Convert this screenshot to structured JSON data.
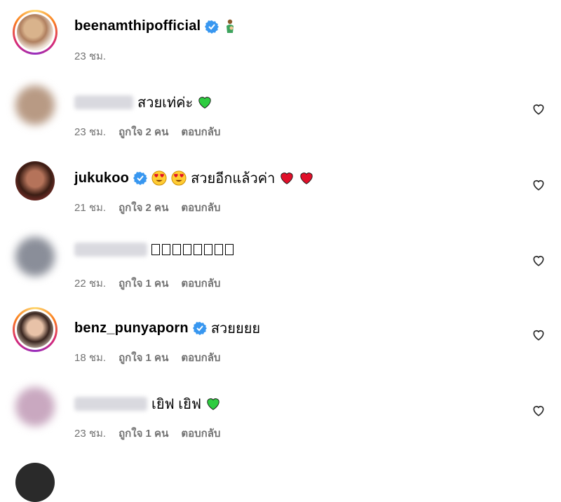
{
  "post": {
    "username": "beenamthipofficial",
    "time": "23 ชม."
  },
  "comments": [
    {
      "username": "",
      "text": "สวยเท่ค่ะ",
      "time": "23 ชม.",
      "likes": "ถูกใจ 2 คน",
      "reply": "ตอบกลับ"
    },
    {
      "username": "jukukoo",
      "text": "สวยอีกแล้วค่า",
      "time": "21 ชม.",
      "likes": "ถูกใจ 2 คน",
      "reply": "ตอบกลับ"
    },
    {
      "username": "",
      "text": "",
      "time": "22 ชม.",
      "likes": "ถูกใจ 1 คน",
      "reply": "ตอบกลับ"
    },
    {
      "username": "benz_punyaporn",
      "text": "สวยยยย",
      "time": "18 ชม.",
      "likes": "ถูกใจ 1 คน",
      "reply": "ตอบกลับ"
    },
    {
      "username": "",
      "text": "เยิฟ เยิฟ",
      "time": "23 ชม.",
      "likes": "ถูกใจ 1 คน",
      "reply": "ตอบกลับ"
    }
  ],
  "colors": {
    "verified": "#3897f0",
    "meta_text": "#737373",
    "green_heart": "#2ecc40",
    "red_heart": "#e0102a"
  }
}
